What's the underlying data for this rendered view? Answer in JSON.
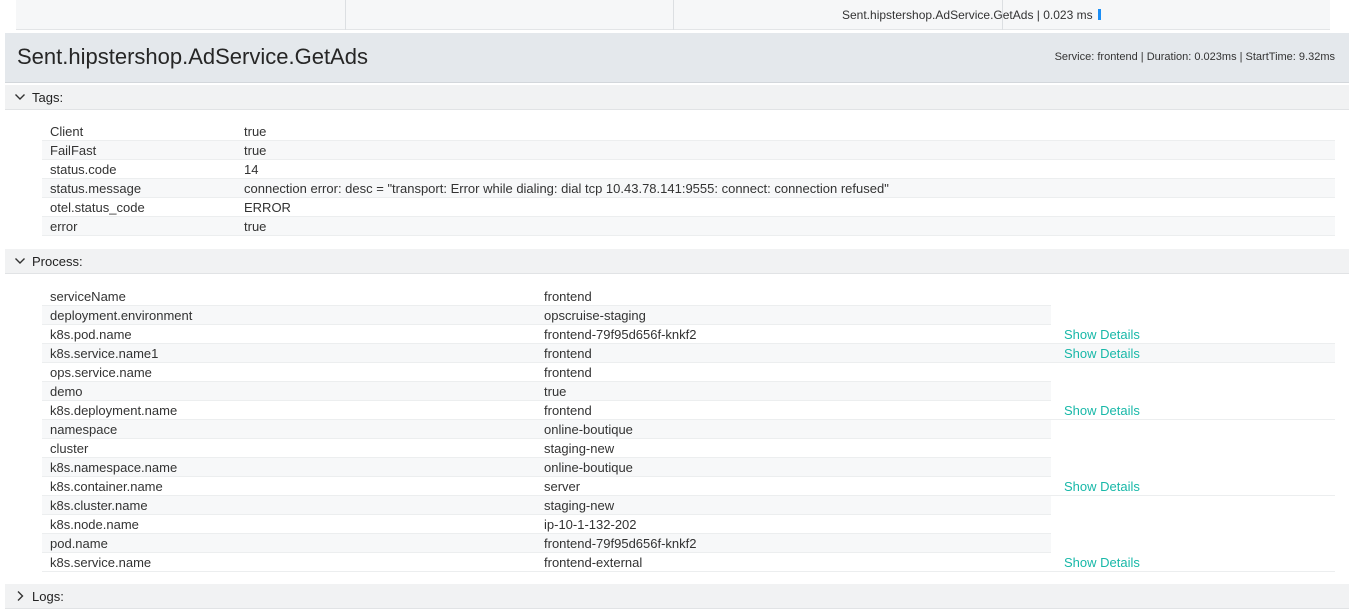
{
  "timeline": {
    "span_label": "Sent.hipstershop.AdService.GetAds | 0.023 ms"
  },
  "header": {
    "title": "Sent.hipstershop.AdService.GetAds",
    "meta": "Service: frontend | Duration: 0.023ms | StartTime: 9.32ms"
  },
  "tags": {
    "label": "Tags:",
    "rows": [
      {
        "key": "Client",
        "value": "true"
      },
      {
        "key": "FailFast",
        "value": "true"
      },
      {
        "key": "status.code",
        "value": "14"
      },
      {
        "key": "status.message",
        "value": "connection error: desc = \"transport: Error while dialing: dial tcp 10.43.78.141:9555: connect: connection refused\""
      },
      {
        "key": "otel.status_code",
        "value": "ERROR"
      },
      {
        "key": "error",
        "value": "true"
      }
    ]
  },
  "process": {
    "label": "Process:",
    "details_label": "Show Details",
    "rows": [
      {
        "key": "serviceName",
        "value": "frontend"
      },
      {
        "key": "deployment.environment",
        "value": "opscruise-staging"
      },
      {
        "key": "k8s.pod.name",
        "value": "frontend-79f95d656f-knkf2",
        "details": "Show Details"
      },
      {
        "key": "k8s.service.name1",
        "value": "frontend",
        "details": "Show Details"
      },
      {
        "key": "ops.service.name",
        "value": "frontend"
      },
      {
        "key": "demo",
        "value": "true"
      },
      {
        "key": "k8s.deployment.name",
        "value": "frontend",
        "details": "Show Details"
      },
      {
        "key": "namespace",
        "value": "online-boutique"
      },
      {
        "key": "cluster",
        "value": "staging-new"
      },
      {
        "key": "k8s.namespace.name",
        "value": "online-boutique"
      },
      {
        "key": "k8s.container.name",
        "value": "server",
        "details": "Show Details"
      },
      {
        "key": "k8s.cluster.name",
        "value": "staging-new"
      },
      {
        "key": "k8s.node.name",
        "value": "ip-10-1-132-202"
      },
      {
        "key": "pod.name",
        "value": "frontend-79f95d656f-knkf2"
      },
      {
        "key": "k8s.service.name",
        "value": "frontend-external",
        "details": "Show Details"
      }
    ]
  },
  "logs": {
    "label": "Logs:"
  },
  "colors": {
    "accent_link": "#18b8a8",
    "span_bar": "#1b8ef5",
    "header_bg": "#e4e8ec"
  }
}
